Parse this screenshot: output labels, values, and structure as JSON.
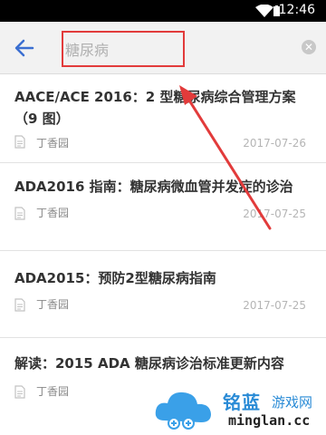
{
  "status_bar": {
    "time": "12:46"
  },
  "search": {
    "query": "糖尿病"
  },
  "results": [
    {
      "title": "AACE/ACE 2016：2 型糖尿病综合管理方案（9 图）",
      "source": "丁香园",
      "date": "2017-07-26"
    },
    {
      "title": "ADA2016 指南：糖尿病微血管并发症的诊治",
      "source": "丁香园",
      "date": "2017-07-25"
    },
    {
      "title": "ADA2015：预防2型糖尿病指南",
      "source": "丁香园",
      "date": "2017-07-25"
    },
    {
      "title": "解读：2015 ADA 糖尿病诊治标准更新内容",
      "source": "丁香园",
      "date": ""
    }
  ],
  "watermark": {
    "brand": "铭蓝",
    "sub": "游戏网",
    "domain": "minglan.cc"
  },
  "colors": {
    "accent_blue": "#3b6fd1",
    "highlight_red": "#e23b3b",
    "watermark_blue": "#2a8bd6"
  }
}
